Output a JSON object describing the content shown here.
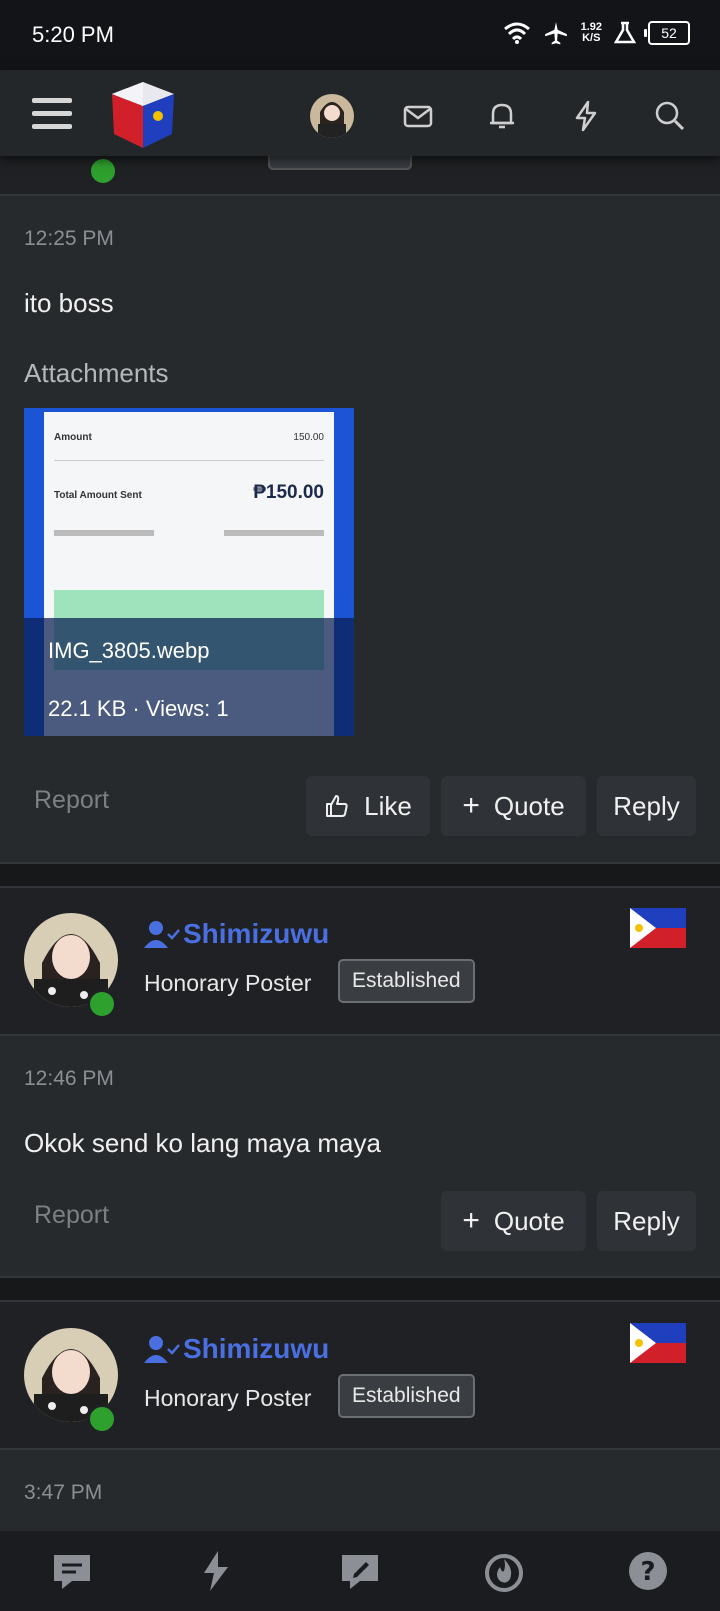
{
  "status_bar": {
    "time": "5:20 PM",
    "speed_value": "1.92",
    "speed_unit": "K/S",
    "battery": "52"
  },
  "header": {
    "icons": [
      "menu-icon",
      "site-logo",
      "user-avatar",
      "mail-icon",
      "bell-icon",
      "lightning-icon",
      "search-icon"
    ]
  },
  "post1": {
    "time": "12:25 PM",
    "body": "ito boss",
    "attachments_label": "Attachments",
    "attachment": {
      "filename": "IMG_3805.webp",
      "meta": "22.1 KB · Views: 1",
      "preview_amount_label": "Amount",
      "preview_amount": "150.00",
      "preview_total_label": "Total Amount Sent",
      "preview_total": "₱150.00"
    },
    "actions": {
      "report": "Report",
      "like": "Like",
      "quote": "Quote",
      "reply": "Reply"
    }
  },
  "post2": {
    "username": "Shimizuwu",
    "user_title": "Honorary Poster",
    "badge": "Established",
    "time": "12:46 PM",
    "body": "Okok send ko lang maya maya",
    "actions": {
      "report": "Report",
      "quote": "Quote",
      "reply": "Reply"
    }
  },
  "post3": {
    "username": "Shimizuwu",
    "user_title": "Honorary Poster",
    "badge": "Established",
    "time": "3:47 PM"
  },
  "bottom_nav": [
    "chat-icon",
    "lightning-icon",
    "compose-icon",
    "fire-icon",
    "help-icon"
  ],
  "colors": {
    "username": "#4a6fe0",
    "online": "#2ea02e",
    "background": "#262a2d"
  }
}
